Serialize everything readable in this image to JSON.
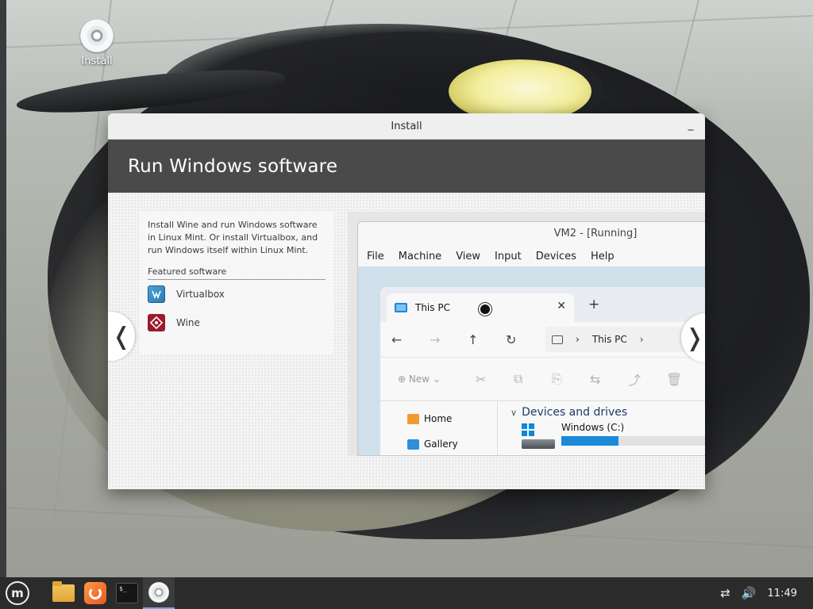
{
  "desktop": {
    "icon_label": "Install"
  },
  "window": {
    "title": "Install",
    "minimize_label": "_",
    "header": "Run Windows software",
    "description": "Install Wine and run Windows software in Linux Mint. Or install Virtualbox, and run Windows itself within Linux Mint.",
    "featured_heading": "Featured software",
    "software": [
      {
        "name": "Virtualbox",
        "icon": "virtualbox-icon"
      },
      {
        "name": "Wine",
        "icon": "wine-icon"
      }
    ],
    "prev_arrow": "❬",
    "next_arrow": "❭"
  },
  "preview": {
    "vm_title": "VM2 - [Running]",
    "vm_menu": [
      "File",
      "Machine",
      "View",
      "Input",
      "Devices",
      "Help"
    ],
    "explorer": {
      "tab_title": "This PC",
      "tab_close": "✕",
      "tab_new": "+",
      "nav": {
        "back": "←",
        "forward": "→",
        "up": "↑",
        "refresh": "↻"
      },
      "address": "This PC",
      "address_sep": "›",
      "toolbar_new": "⊕  New ⌄",
      "toolbar_icons": [
        "✂",
        "⧉",
        "⎘",
        "⇆",
        "⤴",
        "🗑"
      ],
      "sidebar": [
        "Home",
        "Gallery"
      ],
      "section_title": "Devices and drives",
      "drive_name": "Windows (C:)",
      "drive_used_fraction": 0.38
    }
  },
  "taskbar": {
    "menu_label": "m",
    "terminal_label": "$_",
    "network_icon": "⇄",
    "volume_icon": "🔊",
    "clock": "11:49"
  },
  "colors": {
    "header_band": "#4a4a4a",
    "taskbar": "#2b2b2b",
    "accent": "#1c8ad8"
  }
}
